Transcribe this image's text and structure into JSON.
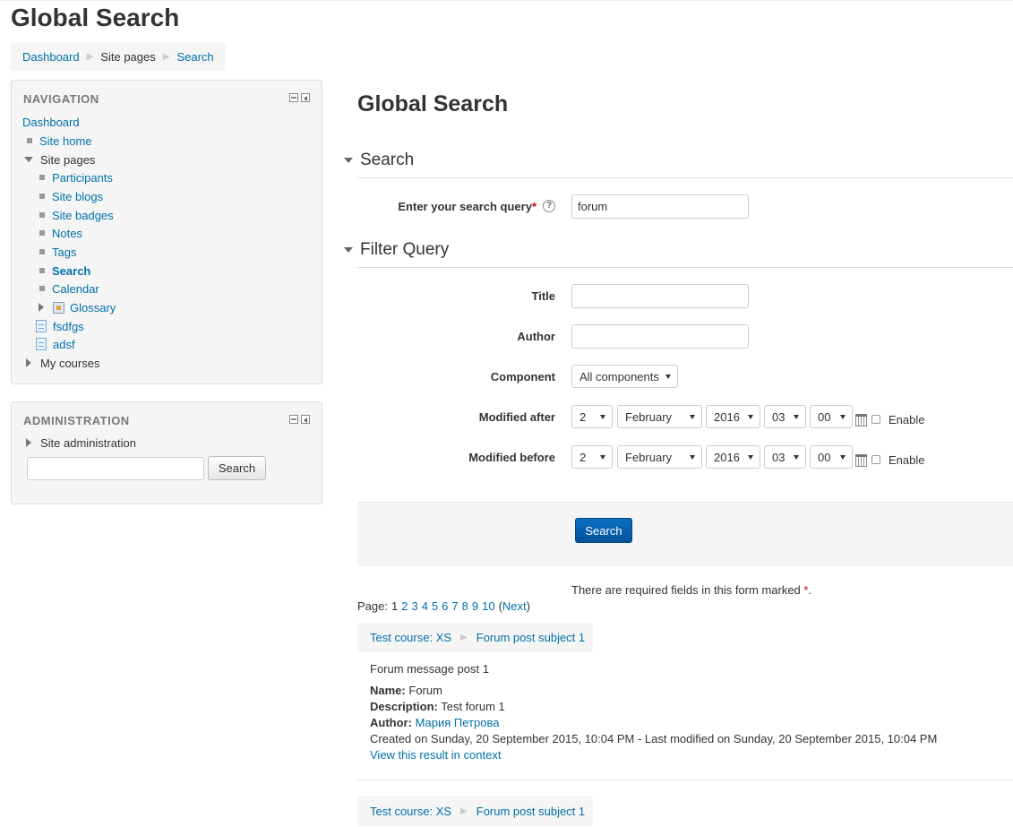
{
  "page": {
    "header_title": "Global Search",
    "main_title": "Global Search"
  },
  "breadcrumb": {
    "items": [
      "Dashboard",
      "Site pages",
      "Search"
    ]
  },
  "navigation": {
    "title": "NAVIGATION",
    "dashboard": "Dashboard",
    "site_home": "Site home",
    "site_pages": "Site pages",
    "children": [
      "Participants",
      "Site blogs",
      "Site badges",
      "Notes",
      "Tags",
      "Search",
      "Calendar"
    ],
    "glossary": "Glossary",
    "pages": [
      "fsdfgs",
      "adsf"
    ],
    "my_courses": "My courses"
  },
  "administration": {
    "title": "ADMINISTRATION",
    "site_admin": "Site administration",
    "search_button": "Search"
  },
  "search_section": {
    "legend": "Search",
    "query_label": "Enter your search query",
    "required_mark": "*",
    "help_icon": "?",
    "query_value": "forum"
  },
  "filter_section": {
    "legend": "Filter Query",
    "title_label": "Title",
    "author_label": "Author",
    "component_label": "Component",
    "component_value": "All components",
    "modified_after_label": "Modified after",
    "modified_before_label": "Modified before",
    "after": {
      "day": "2",
      "month": "February",
      "year": "2016",
      "hour": "03",
      "minute": "00"
    },
    "before": {
      "day": "2",
      "month": "February",
      "year": "2016",
      "hour": "03",
      "minute": "00"
    },
    "enable_label": "Enable"
  },
  "actions": {
    "search_button": "Search",
    "required_note": "There are required fields in this form marked",
    "required_mark": "*",
    "required_end": "."
  },
  "pager": {
    "label": "Page:",
    "current": "1",
    "pages": [
      "2",
      "3",
      "4",
      "5",
      "6",
      "7",
      "8",
      "9",
      "10"
    ],
    "open_paren": "(",
    "next": "Next",
    "close_paren": ")"
  },
  "results": [
    {
      "course": "Test course: XS",
      "subject": "Forum post subject 1",
      "message": "Forum message post 1",
      "name_label": "Name:",
      "name": "Forum",
      "description_label": "Description:",
      "description": "Test forum 1",
      "author_label": "Author:",
      "author": "Мария Петрова",
      "dates": "Created on Sunday, 20 September 2015, 10:04 PM - Last modified on Sunday, 20 September 2015, 10:04 PM",
      "view_link": "View this result in context"
    },
    {
      "course": "Test course: XS",
      "subject": "Forum post subject 1"
    }
  ],
  "icons": {
    "breadcrumb_separator": "triangle-right-icon",
    "block_minimize": "minimize-icon",
    "block_dock": "dock-icon",
    "calendar": "calendar-icon",
    "help": "help-icon"
  },
  "colors": {
    "link": "#0070a8",
    "primary_button": "#0a6fc2",
    "required": "#cc0000",
    "panel_bg": "#f5f5f5"
  }
}
